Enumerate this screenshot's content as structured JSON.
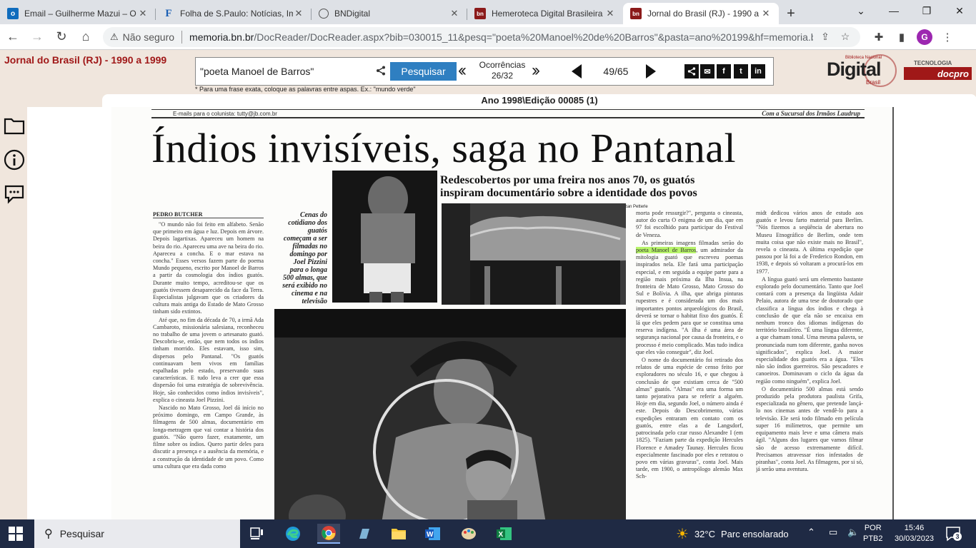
{
  "browser": {
    "tabs": [
      {
        "title": "Email – Guilherme Mazui – O",
        "icon": "outlook-icon"
      },
      {
        "title": "Folha de S.Paulo: Notícias, Im",
        "icon": "folha-icon"
      },
      {
        "title": "BNDigital",
        "icon": "globe-icon"
      },
      {
        "title": "Hemeroteca Digital Brasileira",
        "icon": "bn-icon"
      },
      {
        "title": "Jornal do Brasil (RJ) - 1990 a",
        "icon": "bn-icon"
      }
    ],
    "active_tab": 4,
    "new_tab": "+",
    "security_label": "Não seguro",
    "url_host": "memoria.bn.br",
    "url_path": "/DocReader/DocReader.aspx?bib=030015_11&pesq=\"poeta%20Manoel%20de%20Barros\"&pasta=ano%20199&hf=memoria.bn...",
    "profile_initial": "G"
  },
  "site": {
    "title": "Jornal do Brasil (RJ) - 1990 a 1999",
    "search_value": "\"poeta Manoel de Barros\"",
    "search_button": "Pesquisar",
    "occurrences_label": "Ocorrências",
    "occurrences_value": "26/32",
    "page_current": "49",
    "page_total": "/65",
    "hint": "* Para uma frase exata, coloque as palavras entre aspas. Ex.: \"mundo verde\"",
    "logo_word": "Digital",
    "logo_sub": "Biblioteca Nacional",
    "logo_brasil": "Brasil",
    "docpro_tagline": "TECNOLOGIA",
    "docpro_name": "docpro",
    "issue": "Ano 1998\\Edição 00085 (1)"
  },
  "newspaper": {
    "strip_left": "E-mails para o colunista: tutty@jb.com.br",
    "strip_right": "Com a Sucursal dos Irmãos Laudrup",
    "headline": "Índios invisíveis, saga no Pantanal",
    "deck": "Redescobertos por uma freira nos anos 70, os guatós inspiram documentário sobre a identidade dos povos",
    "photo_credit": "Fotos de divulgação/ Izan Petterle",
    "byline": "PEDRO BUTCHER",
    "caption": "Cenas do cotidiano dos guatós começam a ser filmadas no domingo por Joel Pizzini para o longa 500 almas, que será exibido no cinema e na televisão",
    "col1_p1": "\"O mundo não foi feito em alfabeto. Senão que primeiro em água e luz. Depois em árvore. Depois lagartixas. Apareceu um homem na beira do rio. Apareceu uma ave na beira do rio. Apareceu a concha. E o mar estava na concha.\" Esses versos fazem parte do poema Mundo pequeno, escrito por Manoel de Barros a partir da cosmologia dos índios guatós. Durante muito tempo, acreditou-se que os guatós tivessem desaparecido da face da Terra. Especialistas julgavam que os criadores da cultura mais antiga do Estado de Mato Grosso tinham sido extintos.",
    "col1_p2": "Até que, no fim da década de 70, a irmã Ada Cambaroto, missionária salesiana, reconheceu no trabalho de uma jovem o artesanato guató. Descobriu-se, então, que nem todos os índios tinham morrido. Eles estavam, isso sim, dispersos pelo Pantanal. \"Os guatós continuavam bem vivos em famílias espalhadas pelo estado, preservando suas características. E tudo leva a crer que essa dispersão foi uma estratégia de sobrevivência. Hoje, são conhecidos como índios invisíveis\", explica o cineasta Joel Pizzini.",
    "col1_p3": "Nascido no Mato Grosso, Joel dá início no próximo domingo, em Campo Grande, às filmagens de 500 almas, documentário em longa-metragem que vai contar a história dos guatós. \"Não quero fazer, exatamente, um filme sobre os índios. Quero partir deles para discutir a presença e a ausência da memória, e a construção da identidade de um povo. Como uma cultura que era dada como",
    "col3_p1": "morta pode ressurgir?\", pergunta o cineasta, autor do curta O enigma de um dia, que em 97 foi escolhido para participar do Festival de Veneza.",
    "col3_p2_a": "As primeiras imagens filmadas serão do ",
    "col3_p2_hl": "poeta Manoel de Barros",
    "col3_p2_b": ", um admirador da mitologia guató que escreveu poemas inspirados nela. Ele fará uma participação especial, e em seguida a equipe parte para a região mais próxima da Ilha Insua, na fronteira de Mato Grosso, Mato Grosso do Sul e Bolívia. A ilha, que abriga pinturas rupestres e é considerada um dos mais importantes pontos arqueológicos do Brasil, deverá se tornar o habitat fixo dos guatós. É lá que eles pedem para que se constitua uma reserva indígena. \"A ilha é uma área de segurança nacional por causa da fronteira, e o processo é meio complicado. Mas tudo indica que eles vão conseguir\", diz Joel.",
    "col3_p3": "O nome do documentário foi retirado dos relatos de uma espécie de censo feito por exploradores no século 16, e que chegou à conclusão de que existiam cerca de \"500 almas\" guatós. \"Almas\" era uma forma um tanto pejorativa para se referir a alguém. Hoje em dia, segundo Joel, o número ainda é este. Depois do Descobrimento, várias expedições entraram em contato com os guatós, entre elas a de Langsdorf, patrocinada pelo czar russo Alexandre I (em 1825). \"Faziam parte da expedição Hercules Florence e Amadey Taunay. Hercules ficou especialmente fascinado por eles e retratou o povo em várias gravuras\", conta Joel. Mais tarde, em 1900, o antropólogo alemão Max Sch-",
    "col4_p1": "midt dedicou vários anos de estudo aos guatós e levou farto material para Berlim. \"Nós fizemos a seqüência de abertura no Museu Etnográfico de Berlim, onde tem muita coisa que não existe mais no Brasil\", revela o cineasta. A última expedição que passou por lá foi a de Frederico Rondon, em 1938, e depois só voltaram a procurá-los em 1977.",
    "col4_p2": "A língua guató será um elemento bastante explorado pelo documentário. Tanto que Joel contará com a presença da lingüista Adair Pelaio, autora de uma tese de doutorado que classifica a língua dos índios e chega à conclusão de que ela não se encaixa em nenhum tronco dos idiomas indígenas do território brasileiro. \"É uma língua diferente, a que chamam tonal. Uma mesma palavra, se pronunciada num tom diferente, ganha novos significados\", explica Joel. A maior especialidade dos guatós era a água. \"Eles não são índios guerreiros. São pescadores e canoeiros. Dominavam o ciclo da água da região como ninguém\", explica Joel.",
    "col4_p3": "O documentário 500 almas está sendo produzido pela produtora paulista Grifa, especializada no gênero, que pretende lançá-lo nos cinemas antes de vendê-lo para a televisão. Ele será todo filmado em película super 16 milímetros, que permite um equipamento mais leve e uma câmera mais ágil. \"Alguns dos lugares que vamos filmar são de acesso extremamente difícil. Precisamos atravessar rios infestados de piranhas\", conta Joel. As filmagens, por si só, já serão uma aventura."
  },
  "taskbar": {
    "search_placeholder": "Pesquisar",
    "weather_temp": "32°C",
    "weather_text": "Parc ensolarado",
    "lang_line1": "POR",
    "lang_line2": "PTB2",
    "time": "15:46",
    "date": "30/03/2023",
    "notif_count": "3"
  }
}
